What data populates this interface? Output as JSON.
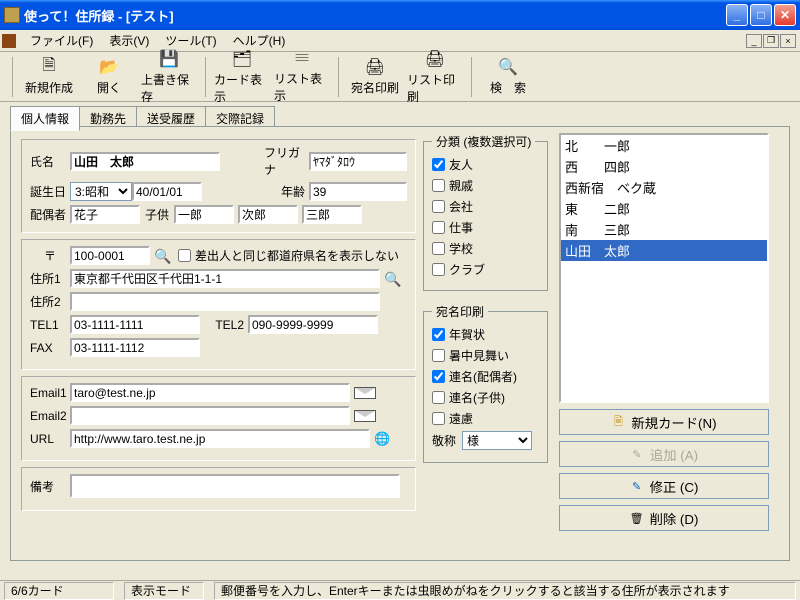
{
  "title": "使って！住所録 - [テスト]",
  "menus": {
    "file": "ファイル(F)",
    "view": "表示(V)",
    "tools": "ツール(T)",
    "help": "ヘルプ(H)"
  },
  "toolbar": {
    "new": "新規作成",
    "open": "開く",
    "save": "上書き保存",
    "card": "カード表示",
    "list": "リスト表示",
    "addr_print": "宛名印刷",
    "list_print": "リスト印刷",
    "search": "検　索"
  },
  "tabs": {
    "personal": "個人情報",
    "work": "勤務先",
    "history": "送受履歴",
    "notes": "交際記録"
  },
  "labels": {
    "name": "氏名",
    "furigana": "フリガナ",
    "birthday": "誕生日",
    "age": "年齢",
    "spouse": "配偶者",
    "child": "子供",
    "zip": "〒",
    "addr1": "住所1",
    "addr2": "住所2",
    "tel1": "TEL1",
    "tel2": "TEL2",
    "fax": "FAX",
    "email1": "Email1",
    "email2": "Email2",
    "url": "URL",
    "memo": "備考",
    "hide_pref": "差出人と同じ都道府県名を表示しない",
    "category_legend": "分類 (複数選択可)",
    "print_legend": "宛名印刷",
    "honorific": "敬称"
  },
  "values": {
    "name": "山田　太郎",
    "furigana": "ﾔﾏﾀﾞﾀﾛｳ",
    "era": "3:昭和",
    "birth_date": "40/01/01",
    "age": "39",
    "spouse": "花子",
    "child1": "一郎",
    "child2": "次郎",
    "child3": "三郎",
    "zip": "100-0001",
    "addr1": "東京都千代田区千代田1-1-1",
    "addr2": "",
    "tel1": "03-1111-1111",
    "tel2": "090-9999-9999",
    "fax": "03-1111-1112",
    "email1": "taro@test.ne.jp",
    "email2": "",
    "url": "http://www.taro.test.ne.jp",
    "memo": "",
    "honorific": "様"
  },
  "categories": {
    "friend": "友人",
    "relative": "親戚",
    "company": "会社",
    "work": "仕事",
    "school": "学校",
    "club": "クラブ"
  },
  "print": {
    "nenga": "年賀状",
    "summer": "暑中見舞い",
    "joint_spouse": "連名(配偶者)",
    "joint_child": "連名(子供)",
    "far": "遠慮"
  },
  "list": [
    "北　　一郎",
    "西　　四郎",
    "西新宿　ベク蔵",
    "東　　二郎",
    "南　　三郎",
    "山田　太郎"
  ],
  "list_selected_index": 5,
  "buttons": {
    "new_card": "新規カード(N)",
    "add": "追加 (A)",
    "edit": "修正 (C)",
    "delete": "削除 (D)"
  },
  "statusbar": {
    "count": "6/6カード",
    "mode": "表示モード",
    "hint": "郵便番号を入力し、Enterキーまたは虫眼めがねをクリックすると該当する住所が表示されます"
  },
  "icons": {
    "new": "🗎",
    "open": "📂",
    "save": "💾",
    "card": "🗂",
    "list": "𝄘",
    "addr_print": "🖨",
    "list_print": "🖨",
    "search": "🔍",
    "magnifier": "🔍",
    "globe": "🌐",
    "doc": "🗎",
    "pencil": "✎",
    "trash": "🗑",
    "wand": "✎"
  }
}
